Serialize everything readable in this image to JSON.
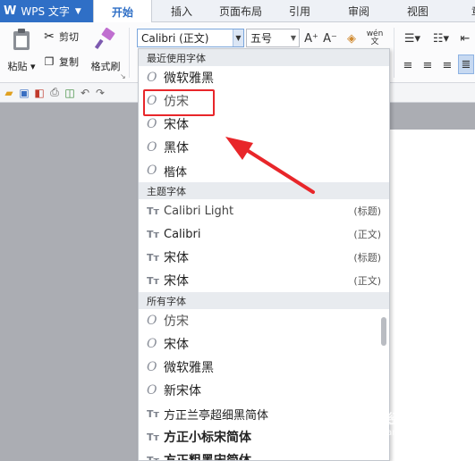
{
  "app": {
    "logo": "W",
    "name": "WPS 文字"
  },
  "tabs": [
    "开始",
    "插入",
    "页面布局",
    "引用",
    "审阅",
    "视图",
    "章"
  ],
  "ribbon": {
    "paste_label": "粘贴",
    "cut_label": "剪切",
    "copy_label": "复制",
    "format_painter_label": "格式刷",
    "font_value": "Calibri (正文)",
    "size_value": "五号",
    "grow_label": "A⁺",
    "shrink_label": "A⁻",
    "wen_label": "wén\n文"
  },
  "dropdown": {
    "recent_header": "最近使用字体",
    "recent_fonts": [
      "微软雅黑",
      "仿宋",
      "宋体",
      "黑体",
      "楷体"
    ],
    "theme_header": "主题字体",
    "theme_fonts": [
      {
        "name": "Calibri Light",
        "tag": "(标题)"
      },
      {
        "name": "Calibri",
        "tag": "(正文)"
      },
      {
        "name": "宋体",
        "tag": "(标题)"
      },
      {
        "name": "宋体",
        "tag": "(正文)"
      }
    ],
    "all_header": "所有字体",
    "all_fonts": [
      {
        "name": "仿宋",
        "icon": "o"
      },
      {
        "name": "宋体",
        "icon": "o"
      },
      {
        "name": "微软雅黑",
        "icon": "o"
      },
      {
        "name": "新宋体",
        "icon": "o"
      },
      {
        "name": "方正兰亭超细黑简体",
        "icon": "tt"
      },
      {
        "name": "方正小标宋简体",
        "icon": "tt"
      },
      {
        "name": "方正粗黑宋简体",
        "icon": "tt"
      }
    ]
  },
  "watermark": {
    "text": "Baidu经验",
    "url": "jingyan.baidu.com"
  },
  "colors": {
    "accent": "#2f6fc6",
    "highlight": "#e8262a"
  }
}
